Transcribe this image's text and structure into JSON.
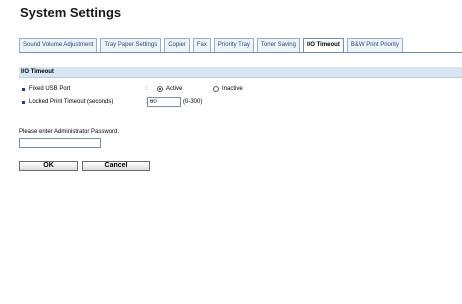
{
  "page": {
    "title": "System Settings"
  },
  "tabs": [
    {
      "label": "Sound Volume Adjustment"
    },
    {
      "label": "Tray Paper Settings"
    },
    {
      "label": "Copier"
    },
    {
      "label": "Fax"
    },
    {
      "label": "Priority Tray"
    },
    {
      "label": "Toner Saving"
    },
    {
      "label": "I/O Timeout"
    },
    {
      "label": "B&W Print Priority"
    }
  ],
  "active_tab": "I/O Timeout",
  "section": {
    "title": "I/O Timeout"
  },
  "settings": {
    "fixed_usb": {
      "label": "Fixed USB Port",
      "separator": ":",
      "options": [
        {
          "label": "Active",
          "selected": true
        },
        {
          "label": "Inactive",
          "selected": false
        }
      ]
    },
    "locked_print": {
      "label": "Locked Print Timeout (seconds)",
      "separator": ":",
      "value": "60",
      "range": "(0-300)"
    }
  },
  "password": {
    "label": "Please enter Administrator Password.",
    "value": ""
  },
  "buttons": {
    "ok": "OK",
    "cancel": "Cancel"
  },
  "colors": {
    "accent": "#1d3f7a",
    "section_bg": "#d8e6f3",
    "tab_border": "#9ab0c8"
  }
}
